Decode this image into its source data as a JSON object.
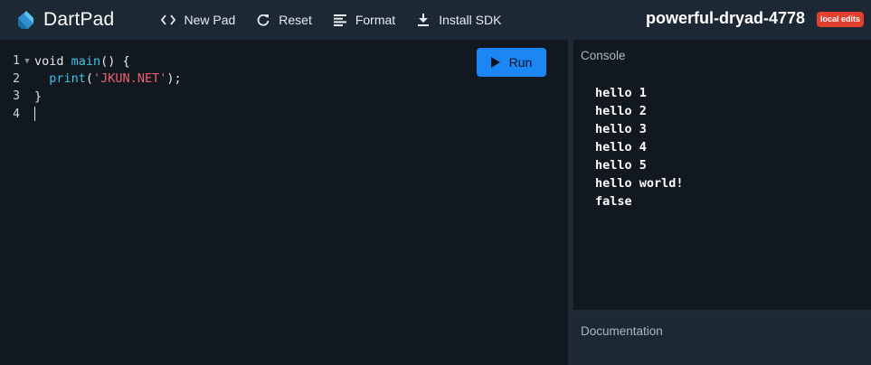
{
  "app": {
    "name": "DartPad",
    "pad_title": "powerful-dryad-4778",
    "badge": "local edits"
  },
  "toolbar": {
    "actions": [
      {
        "label": "New Pad",
        "icon": "code-brackets-icon"
      },
      {
        "label": "Reset",
        "icon": "refresh-icon"
      },
      {
        "label": "Format",
        "icon": "format-align-icon"
      },
      {
        "label": "Install SDK",
        "icon": "download-icon"
      }
    ]
  },
  "editor": {
    "line_numbers": [
      "1",
      "2",
      "3",
      "4"
    ],
    "code": {
      "l1_kw": "void ",
      "l1_fn": "main",
      "l1_rest": "() {",
      "l2_indent": "  ",
      "l2_fn": "print",
      "l2_open": "(",
      "l2_str": "'JKUN.NET'",
      "l2_close": ");",
      "l3": "}"
    },
    "run_label": "Run"
  },
  "console": {
    "title": "Console",
    "output": [
      "hello 1",
      "hello 2",
      "hello 3",
      "hello 4",
      "hello 5",
      "hello world!",
      "false"
    ]
  },
  "documentation": {
    "title": "Documentation"
  },
  "colors": {
    "background": "#111820",
    "topbar": "#1c2834",
    "run_button": "#1b87f5",
    "badge": "#e23f2e",
    "function": "#3dc2e8",
    "string": "#f25f6e"
  }
}
